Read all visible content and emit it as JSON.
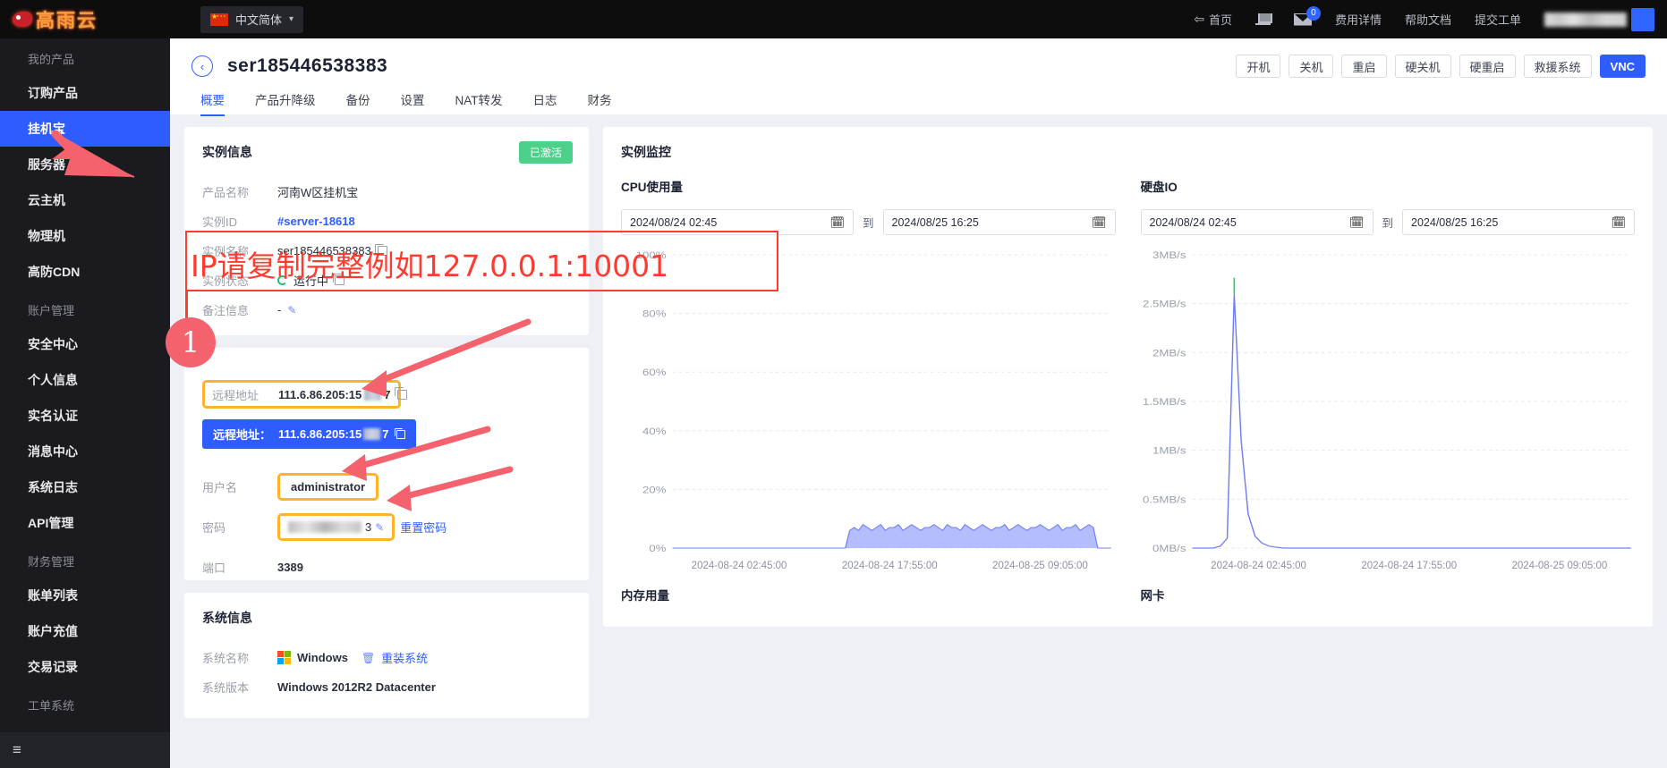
{
  "topbar": {
    "logo_text": "高雨云",
    "language": "中文简体",
    "nav": [
      {
        "label": "首页",
        "icon": "back-arrow-icon"
      },
      {
        "label": "",
        "icon": "cart-icon"
      },
      {
        "label": "",
        "icon": "mail-icon",
        "badge": "0"
      },
      {
        "label": "费用详情",
        "icon": ""
      },
      {
        "label": "帮助文档",
        "icon": ""
      },
      {
        "label": "提交工单",
        "icon": ""
      }
    ],
    "username_masked": "●●●●●●●●"
  },
  "sidebar": {
    "groups": [
      {
        "title": "我的产品",
        "items": [
          {
            "label": "订购产品",
            "active": false
          },
          {
            "label": "挂机宝",
            "active": true
          },
          {
            "label": "服务器",
            "active": false
          },
          {
            "label": "云主机",
            "active": false
          },
          {
            "label": "物理机",
            "active": false
          },
          {
            "label": "高防CDN",
            "active": false
          }
        ]
      },
      {
        "title": "账户管理",
        "items": [
          {
            "label": "安全中心",
            "active": false
          },
          {
            "label": "个人信息",
            "active": false
          },
          {
            "label": "实名认证",
            "active": false
          },
          {
            "label": "消息中心",
            "active": false
          },
          {
            "label": "系统日志",
            "active": false
          },
          {
            "label": "API管理",
            "active": false
          }
        ]
      },
      {
        "title": "财务管理",
        "items": [
          {
            "label": "账单列表",
            "active": false
          },
          {
            "label": "账户充值",
            "active": false
          },
          {
            "label": "交易记录",
            "active": false
          }
        ]
      },
      {
        "title": "工单系统",
        "items": []
      }
    ],
    "collapse_icon": "collapse-menu-icon"
  },
  "page": {
    "title": "ser185446538383",
    "back_icon": "back-chevron-icon",
    "buttons": [
      {
        "label": "开机",
        "primary": false
      },
      {
        "label": "关机",
        "primary": false
      },
      {
        "label": "重启",
        "primary": false
      },
      {
        "label": "硬关机",
        "primary": false
      },
      {
        "label": "硬重启",
        "primary": false
      },
      {
        "label": "救援系统",
        "primary": false
      },
      {
        "label": "VNC",
        "primary": true
      }
    ],
    "tabs": [
      {
        "label": "概要",
        "active": true
      },
      {
        "label": "产品升降级",
        "active": false
      },
      {
        "label": "备份",
        "active": false
      },
      {
        "label": "设置",
        "active": false
      },
      {
        "label": "NAT转发",
        "active": false
      },
      {
        "label": "日志",
        "active": false
      },
      {
        "label": "财务",
        "active": false
      }
    ]
  },
  "instance_info": {
    "title": "实例信息",
    "status_badge": "已激活",
    "rows": [
      {
        "label": "产品名称",
        "value": "河南W区挂机宝"
      },
      {
        "label": "实例ID",
        "value": "#server-18618"
      },
      {
        "label": "实例名称",
        "value": "ser185446538383"
      },
      {
        "label": "实例状态",
        "value": "运行中"
      },
      {
        "label": "备注信息",
        "value": "-"
      }
    ]
  },
  "connection_info": {
    "remote_label": "远程地址",
    "remote_value": "111.6.86.205:15",
    "remote_value_tail": "7",
    "tooltip_label": "远程地址：",
    "tooltip_value": "111.6.86.205:15",
    "tooltip_value_tail": "7",
    "username_label": "用户名",
    "username_value": "administrator",
    "password_label": "密码",
    "password_tail": "3",
    "reset_password": "重置密码",
    "port_label": "端口",
    "port_value": "3389"
  },
  "system_info": {
    "title": "系统信息",
    "os_label": "系统名称",
    "os_value": "Windows",
    "reinstall": "重装系统",
    "version_label": "系统版本",
    "version_value": "Windows 2012R2 Datacenter"
  },
  "monitor": {
    "title": "实例监控",
    "date_separator": "到",
    "date_start": "2024/08/24 02:45",
    "date_end": "2024/08/25 16:25"
  },
  "chart_data": [
    {
      "type": "area",
      "title": "CPU使用量",
      "ylabel": "",
      "xlabel": "",
      "yticks": [
        "0%",
        "20%",
        "40%",
        "60%",
        "80%",
        "100%"
      ],
      "ylim": [
        0,
        100
      ],
      "xticks": [
        "2024-08-24 02:45:00",
        "2024-08-24 17:55:00",
        "2024-08-25 09:05:00"
      ],
      "grid": true,
      "color": "#8d9eff",
      "series": [
        {
          "name": "CPU",
          "values": [
            0,
            0,
            0,
            0,
            0,
            0,
            0,
            0,
            0,
            0,
            0,
            0,
            0,
            0,
            0,
            0,
            0,
            0,
            0,
            0,
            0,
            0,
            0,
            0,
            0,
            0,
            0,
            0,
            0,
            0,
            0,
            0,
            0,
            0,
            0,
            0,
            0,
            0,
            0,
            0,
            6,
            7,
            6,
            8,
            7,
            6,
            7,
            8,
            6,
            7,
            7,
            8,
            6,
            7,
            8,
            7,
            6,
            7,
            7,
            8,
            7,
            6,
            8,
            7,
            7,
            6,
            8,
            7,
            6,
            7,
            8,
            7,
            6,
            7,
            7,
            8,
            6,
            7,
            8,
            7,
            6,
            7,
            7,
            8,
            7,
            6,
            7,
            8,
            6,
            7,
            7,
            8,
            6,
            7,
            8,
            7,
            0,
            0,
            0,
            0
          ]
        }
      ]
    },
    {
      "type": "line",
      "title": "硬盘IO",
      "ylabel": "",
      "xlabel": "",
      "yticks": [
        "0MB/s",
        "0.5MB/s",
        "1MB/s",
        "1.5MB/s",
        "2MB/s",
        "2.5MB/s",
        "3MB/s"
      ],
      "ylim": [
        0,
        3
      ],
      "xticks": [
        "2024-08-24 02:45:00",
        "2024-08-24 17:55:00",
        "2024-08-25 09:05:00"
      ],
      "grid": true,
      "color": "#7f8ff5",
      "peak_value": 2.6,
      "series": [
        {
          "name": "DiskIO",
          "values": [
            0,
            0,
            0,
            0,
            0.02,
            0.1,
            2.6,
            1.1,
            0.35,
            0.12,
            0.05,
            0.02,
            0.01,
            0,
            0,
            0,
            0,
            0,
            0,
            0,
            0,
            0,
            0,
            0,
            0,
            0,
            0,
            0,
            0,
            0,
            0,
            0,
            0,
            0,
            0,
            0,
            0,
            0,
            0,
            0,
            0,
            0,
            0,
            0,
            0,
            0,
            0,
            0,
            0,
            0,
            0,
            0,
            0,
            0,
            0,
            0,
            0,
            0,
            0,
            0,
            0,
            0,
            0,
            0
          ]
        }
      ]
    },
    {
      "type": "area",
      "title": "内存用量",
      "yticks": [],
      "xticks": [],
      "grid": true,
      "color": "#8d9eff",
      "series": [
        {
          "name": "Memory",
          "values": []
        }
      ]
    },
    {
      "type": "line",
      "title": "网卡",
      "yticks": [],
      "xticks": [],
      "grid": true,
      "color": "#8d9eff",
      "series": [
        {
          "name": "Network",
          "values": []
        }
      ]
    }
  ],
  "annotations": {
    "red_note": "IP请复制完整例如127.0.0.1:10001",
    "step_number": "1"
  }
}
